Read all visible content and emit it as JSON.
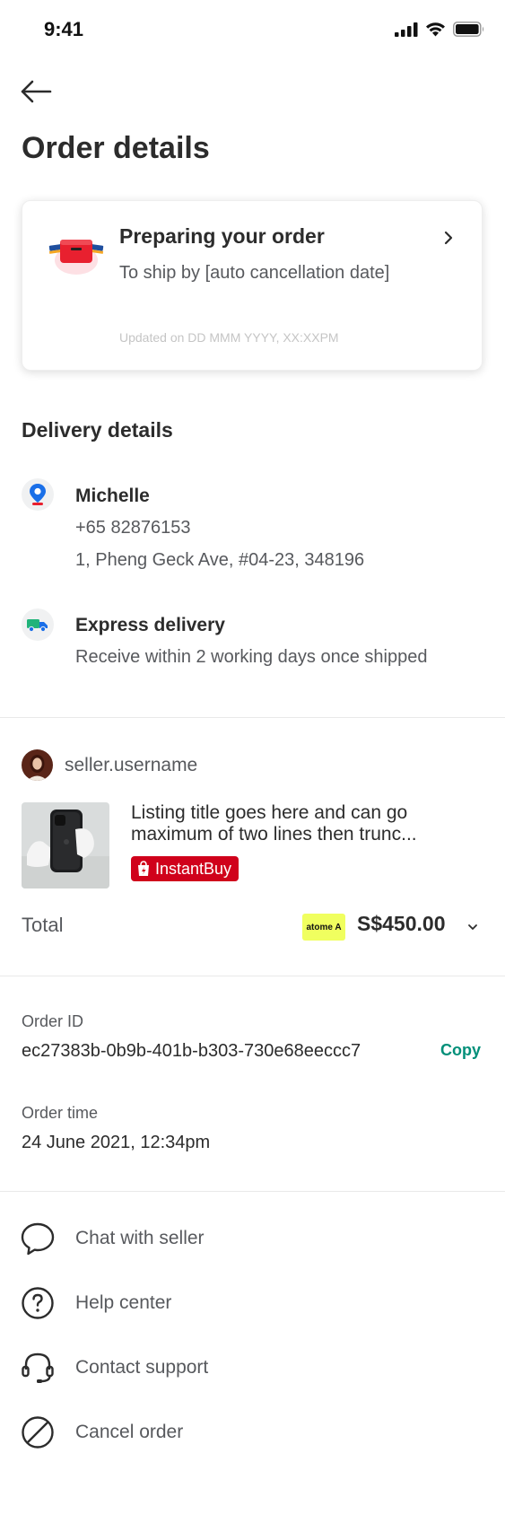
{
  "status_bar": {
    "time": "9:41"
  },
  "header": {
    "title": "Order details"
  },
  "status_card": {
    "title": "Preparing your order",
    "subtitle": "To ship by [auto cancellation date]",
    "updated": "Updated on DD MMM YYYY, XX:XXPM"
  },
  "delivery": {
    "heading": "Delivery details",
    "address": {
      "name": "Michelle",
      "phone": "+65 82876153",
      "address": "1, Pheng Geck Ave, #04-23, 348196"
    },
    "method": {
      "title": "Express delivery",
      "description": "Receive within 2 working days once shipped"
    }
  },
  "seller": {
    "username": "seller.username"
  },
  "product": {
    "title": "Listing title goes here and can go maximum of two lines then trunc...",
    "badge": "InstantBuy"
  },
  "total": {
    "label": "Total",
    "payment_badge": "atome A",
    "amount": "S$450.00"
  },
  "order_info": {
    "id_label": "Order ID",
    "id_value": "ec27383b-0b9b-401b-b303-730e68eeccc7",
    "copy_label": "Copy",
    "time_label": "Order time",
    "time_value": "24 June 2021, 12:34pm"
  },
  "actions": [
    {
      "label": "Chat with seller",
      "icon": "chat-bubble-icon"
    },
    {
      "label": "Help center",
      "icon": "question-circle-icon"
    },
    {
      "label": "Contact support",
      "icon": "headset-icon"
    },
    {
      "label": "Cancel order",
      "icon": "cancel-circle-icon"
    }
  ],
  "colors": {
    "text_primary": "#2c2c2c",
    "text_secondary": "#57595d",
    "accent_green": "#008f79",
    "badge_red": "#d0011b",
    "atome_yellow": "#f0ff5f"
  }
}
